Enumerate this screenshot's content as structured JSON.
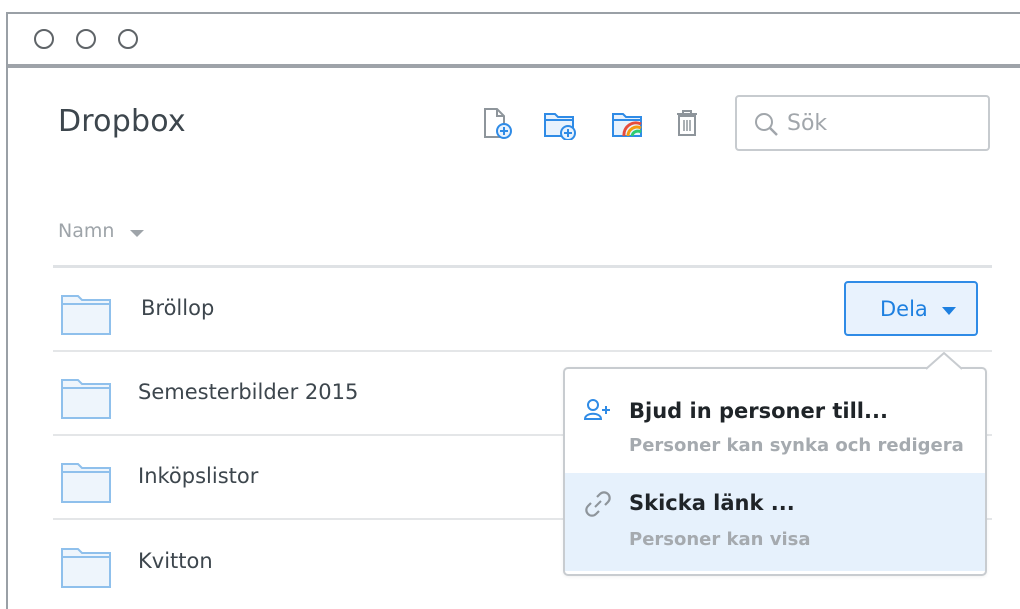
{
  "window": {
    "title": "Dropbox"
  },
  "toolbar": {
    "icons": [
      "new-file-icon",
      "new-folder-icon",
      "shared-folder-icon",
      "trash-icon"
    ]
  },
  "search": {
    "placeholder": "Sök"
  },
  "list": {
    "column_header": "Namn",
    "rows": [
      {
        "name": "Bröllop",
        "icon": "folder-icon"
      },
      {
        "name": "Semesterbilder 2015",
        "icon": "folder-icon"
      },
      {
        "name": "Inköpslistor",
        "icon": "folder-icon"
      },
      {
        "name": "Kvitton",
        "icon": "folder-icon"
      }
    ]
  },
  "share_button": {
    "label": "Dela"
  },
  "share_menu": {
    "items": [
      {
        "title": "Bjud in personer till...",
        "subtitle": "Personer kan synka och redigera",
        "icon": "invite-person-icon"
      },
      {
        "title": "Skicka länk ...",
        "subtitle": "Personer kan visa",
        "icon": "link-icon",
        "highlighted": true
      }
    ]
  },
  "colors": {
    "accent": "#1e80e0",
    "folder_fill": "#eef5fc",
    "folder_stroke": "#8fc0ec",
    "menu_highlight": "#e6f1fc"
  }
}
